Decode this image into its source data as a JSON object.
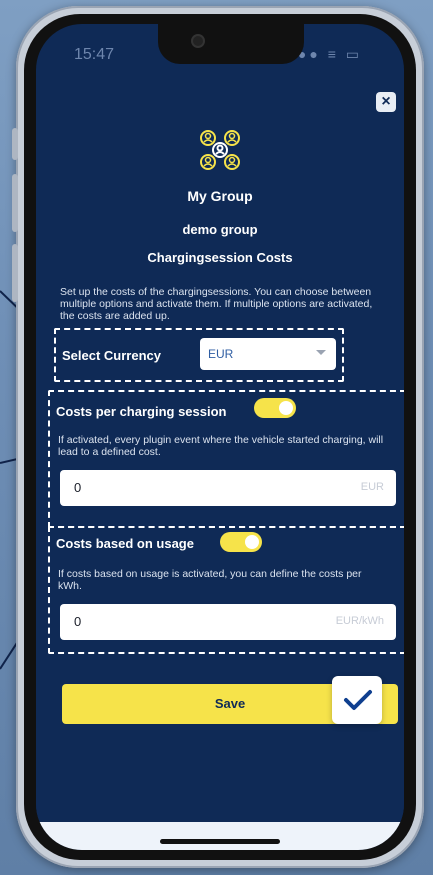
{
  "status": {
    "time": "15:47",
    "icons": "●●● ≡ ▭"
  },
  "modal": {
    "close_label": "×",
    "group_label": "My Group",
    "group_name": "demo group",
    "section_title": "Chargingsession Costs",
    "description": "Set up the costs of the chargingsessions. You can choose between multiple options and activate them. If multiple options are activated, the costs are added up."
  },
  "currency": {
    "label": "Select Currency",
    "selected": "EUR"
  },
  "per_session": {
    "label": "Costs per charging session",
    "enabled": true,
    "info": "If activated, every plugin event where the vehicle started charging, will lead to a defined cost.",
    "value": "0",
    "unit": "EUR"
  },
  "usage": {
    "label": "Costs based on usage",
    "enabled": true,
    "info": "If costs based on usage is activated, you can define the costs per kWh.",
    "value": "0",
    "unit": "EUR/kWh"
  },
  "actions": {
    "save_label": "Save"
  },
  "colors": {
    "accent_yellow": "#f6e34a",
    "screen_navy": "#0f2a56",
    "select_text": "#2f5ea3"
  }
}
